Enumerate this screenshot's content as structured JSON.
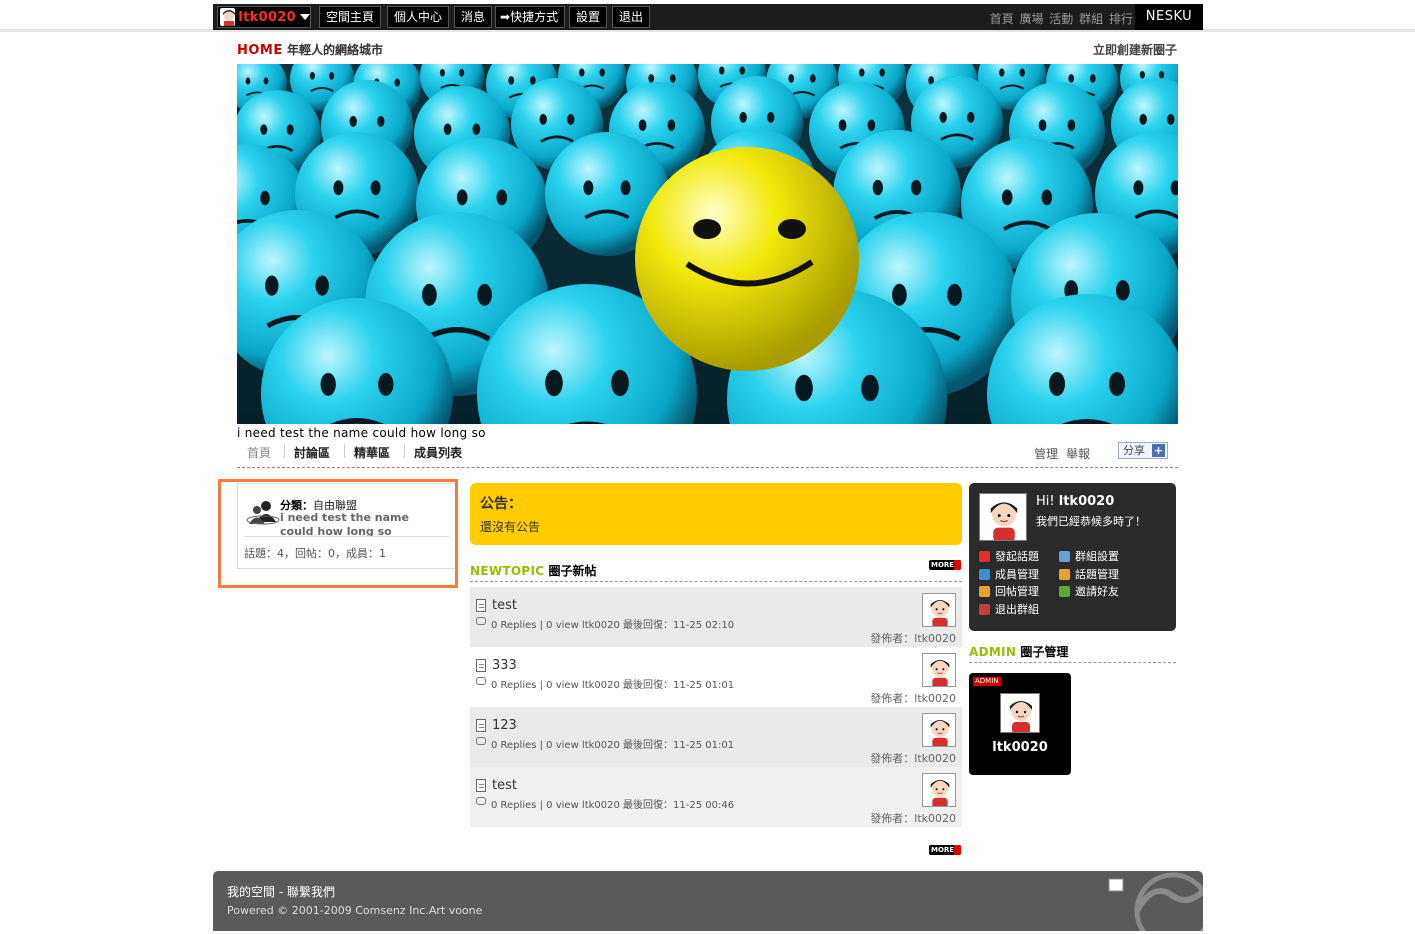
{
  "topbar": {
    "username": "ltk0020",
    "buttons": [
      "空間主頁",
      "個人中心",
      "消息",
      "快捷方式",
      "設置",
      "退出"
    ],
    "right_links": [
      "首頁",
      "廣場",
      "活動",
      "群組",
      "排行"
    ],
    "brand": "NESKU"
  },
  "header": {
    "home": "HOME",
    "tagline": "年輕人的網絡城市",
    "create_link": "立即創建新圈子"
  },
  "group": {
    "name": "i need test the name could how long so"
  },
  "subnav": {
    "items": [
      "首頁",
      "討論區",
      "精華區",
      "成員列表"
    ],
    "admin": "管理",
    "report": "舉報",
    "share": "分享"
  },
  "category": {
    "label": "分類：",
    "value": "自由聯盟",
    "desc": "i need test the name could how long so",
    "stats": "話題：4，回帖：0，成員：1"
  },
  "announcement": {
    "title": "公告：",
    "body": "還沒有公告"
  },
  "newtopic": {
    "en": "NEWTOPIC",
    "zh": "圈子新帖",
    "more": "MORE",
    "topics": [
      {
        "title": "test",
        "meta": "0 Replies | 0 view ltk0020 最後回復：11-25 02:10",
        "poster": "發佈者：ltk0020"
      },
      {
        "title": "333",
        "meta": "0 Replies | 0 view ltk0020 最後回復：11-25 01:01",
        "poster": "發佈者：ltk0020"
      },
      {
        "title": "123",
        "meta": "0 Replies | 0 view ltk0020 最後回復：11-25 01:01",
        "poster": "發佈者：ltk0020"
      },
      {
        "title": "test",
        "meta": "0 Replies | 0 view ltk0020 最後回復：11-25 00:46",
        "poster": "發佈者：ltk0020"
      }
    ]
  },
  "welcome": {
    "hi": "Hi!",
    "name": "ltk0020",
    "sub": "我們已經恭候多時了！",
    "actions": [
      "發起話題",
      "群組設置",
      "成員管理",
      "話題管理",
      "回帖管理",
      "邀請好友",
      "退出群組"
    ],
    "action_colors": [
      "#e03030",
      "#6aa0d0",
      "#3a8fd0",
      "#e8a030",
      "#e8a030",
      "#5aaa3a",
      "#c04040"
    ]
  },
  "admin": {
    "en": "ADMIN",
    "zh": "圈子管理",
    "tag": "ADMIN",
    "name": "ltk0020"
  },
  "footer": {
    "line1": "我的空間 - 聯繫我們",
    "line2": "Powered © 2001-2009 Comsenz Inc.Art voone"
  },
  "colors": {
    "highlight": "#f47c3c",
    "announce": "#ffcc00",
    "accent_green": "#99bb00",
    "username_red": "#ff2b2b"
  }
}
